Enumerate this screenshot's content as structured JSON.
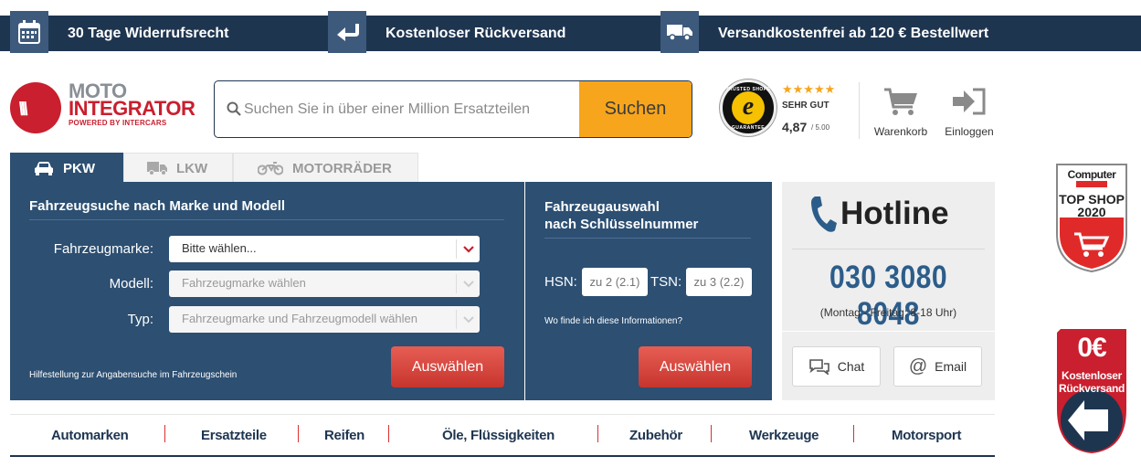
{
  "benefits": [
    {
      "label": "30 Tage Widerrufsrecht",
      "icon": "calendar-icon"
    },
    {
      "label": "Kostenloser Rückversand",
      "icon": "return-arrow-icon"
    },
    {
      "label": "Versandkostenfrei ab 120 € Bestellwert",
      "icon": "truck-icon"
    }
  ],
  "logo": {
    "line1": "MOTO",
    "line2": "INTEGRATOR",
    "line3": "POWERED BY INTERCARS"
  },
  "search": {
    "placeholder": "Suchen Sie in über einer Million Ersatzteilen",
    "value": "",
    "button": "Suchen"
  },
  "trusted_shops": {
    "stars": "★★★★★",
    "grade": "SEHR GUT",
    "score": "4,87",
    "scale": "/ 5.00",
    "seal_top": "TRUSTED SHOPS",
    "seal_bottom": "GUARANTEE"
  },
  "header_actions": {
    "cart": "Warenkorb",
    "login": "Einloggen"
  },
  "tabs": [
    {
      "label": "PKW",
      "icon": "car-icon",
      "active": true
    },
    {
      "label": "LKW",
      "icon": "truck-icon",
      "active": false
    },
    {
      "label": "MOTORRÄDER",
      "icon": "motorcycle-icon",
      "active": false
    }
  ],
  "vehicle_search": {
    "title": "Fahrzeugsuche nach Marke und Modell",
    "fields": [
      {
        "label": "Fahrzeugmarke:",
        "value": "Bitte wählen...",
        "enabled": true
      },
      {
        "label": "Modell:",
        "value": "Fahrzeugmarke wählen",
        "enabled": false
      },
      {
        "label": "Typ:",
        "value": "Fahrzeugmarke und Fahrzeugmodell wählen",
        "enabled": false
      }
    ],
    "help": "Hilfestellung zur Angabensuche im Fahrzeugschein",
    "button": "Auswählen"
  },
  "key_search": {
    "title_line1": "Fahrzeugauswahl",
    "title_line2": "nach Schlüsselnummer",
    "hsn_label": "HSN:",
    "hsn_placeholder": "zu 2 (2.1)",
    "tsn_label": "TSN:",
    "tsn_placeholder": "zu 3 (2.2)",
    "help": "Wo finde ich diese Informationen?",
    "button": "Auswählen"
  },
  "hotline": {
    "title": "Hotline",
    "phone": "030 3080 8048",
    "hours": "(Montag - Freitag: 8-18 Uhr)",
    "chat": "Chat",
    "email": "Email"
  },
  "nav": [
    "Automarken",
    "Ersatzteile",
    "Reifen",
    "Öle, Flüssigkeiten",
    "Zubehör",
    "Werkzeuge",
    "Motorsport"
  ],
  "badges": {
    "computer_bild": {
      "line1": "Computer",
      "line2": "TOP SHOP",
      "line3": "2020"
    },
    "free_return": {
      "line1": "0€",
      "line2": "Kostenloser",
      "line3": "Rückversand"
    }
  },
  "colors": {
    "navy": "#1e3550",
    "panel": "#2c4f72",
    "orange": "#f7a51c",
    "red": "#c91f2e"
  }
}
